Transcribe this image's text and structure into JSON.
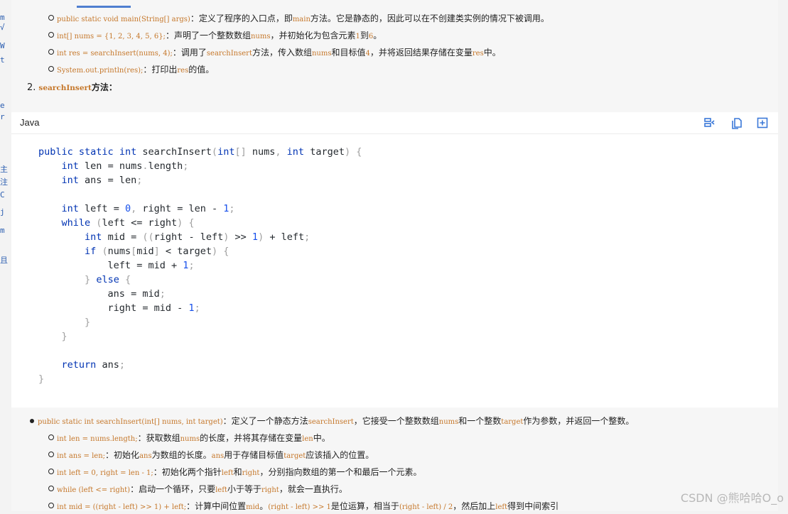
{
  "top_list": [
    {
      "code": "public static void main(String[] args)",
      "text": "：定义了程序的入口点，即",
      "code2": "main",
      "text2": "方法。它是静态的，因此可以在不创建类实例的情况下被调用。"
    },
    {
      "code": "int[] nums = {1, 2, 3, 4, 5, 6};",
      "text": "：声明了一个整数数组",
      "code2": "nums",
      "text2": "，并初始化为包含元素",
      "code3": "1",
      "text3": "到",
      "code4": "6",
      "text4": "。"
    },
    {
      "code": "int res = searchInsert(nums, 4);",
      "text": "：调用了",
      "code2": "searchInsert",
      "text2": "方法，传入数组",
      "code3": "nums",
      "text3": "和目标值",
      "code4": "4",
      "text4": "，并将返回结果存储在变量",
      "code5": "res",
      "text5": "中。"
    },
    {
      "code": "System.out.println(res);",
      "text": "：打印出",
      "code2": "res",
      "text2": "的值。"
    }
  ],
  "section2": {
    "number": "2.",
    "code": "searchInsert",
    "text": "方法："
  },
  "codeblock": {
    "language": "Java",
    "lines": [
      "public static int searchInsert(int[] nums, int target) {",
      "    int len = nums.length;",
      "    int ans = len;",
      "",
      "    int left = 0, right = len - 1;",
      "    while (left <= right) {",
      "        int mid = ((right - left) >> 1) + left;",
      "        if (nums[mid] < target) {",
      "            left = mid + 1;",
      "        } else {",
      "            ans = mid;",
      "            right = mid - 1;",
      "        }",
      "    }",
      "",
      "    return ans;",
      "}"
    ]
  },
  "bottom_main": {
    "code": "public static int searchInsert(int[] nums, int target)",
    "text": "：定义了一个静态方法",
    "code2": "searchInsert",
    "text2": "，它接受一个整数数组",
    "code3": "nums",
    "text3": "和一个整数",
    "code4": "target",
    "text4": "作为参数，并返回一个整数。"
  },
  "bottom_list": [
    {
      "code": "int len = nums.length;",
      "text": "：获取数组",
      "code2": "nums",
      "text2": "的长度，并将其存储在变量",
      "code3": "len",
      "text3": "中。"
    },
    {
      "code": "int ans = len;",
      "text": "：初始化",
      "code2": "ans",
      "text2": "为数组的长度。",
      "code3": "ans",
      "text3": "用于存储目标值",
      "code4": "target",
      "text4": "应该插入的位置。"
    },
    {
      "code": "int left = 0, right = len - 1;",
      "text": "：初始化两个指针",
      "code2": "left",
      "text2": "和",
      "code3": "right",
      "text3": "，分别指向数组的第一个和最后一个元素。"
    },
    {
      "code": "while (left <= right)",
      "text": "：启动一个循环，只要",
      "code2": "left",
      "text2": "小于等于",
      "code3": "right",
      "text3": "，就会一直执行。"
    },
    {
      "code": "int mid = ((right - left) >> 1) + left;",
      "text": "：计算中间位置",
      "code2": "mid",
      "text2": "。",
      "code3": "(right - left) >> 1",
      "text3": "是位运算，相当于",
      "code4": "(right - left) / 2",
      "text4": "，然后加上",
      "code5": "left",
      "text5": "得到中间索引"
    }
  ],
  "watermark": "CSDN @熊哈哈O_o",
  "left_edge_chars": [
    "m",
    "√",
    "W",
    "t",
    "e",
    "r",
    "主",
    "注",
    "C",
    "j",
    "m",
    "且"
  ]
}
